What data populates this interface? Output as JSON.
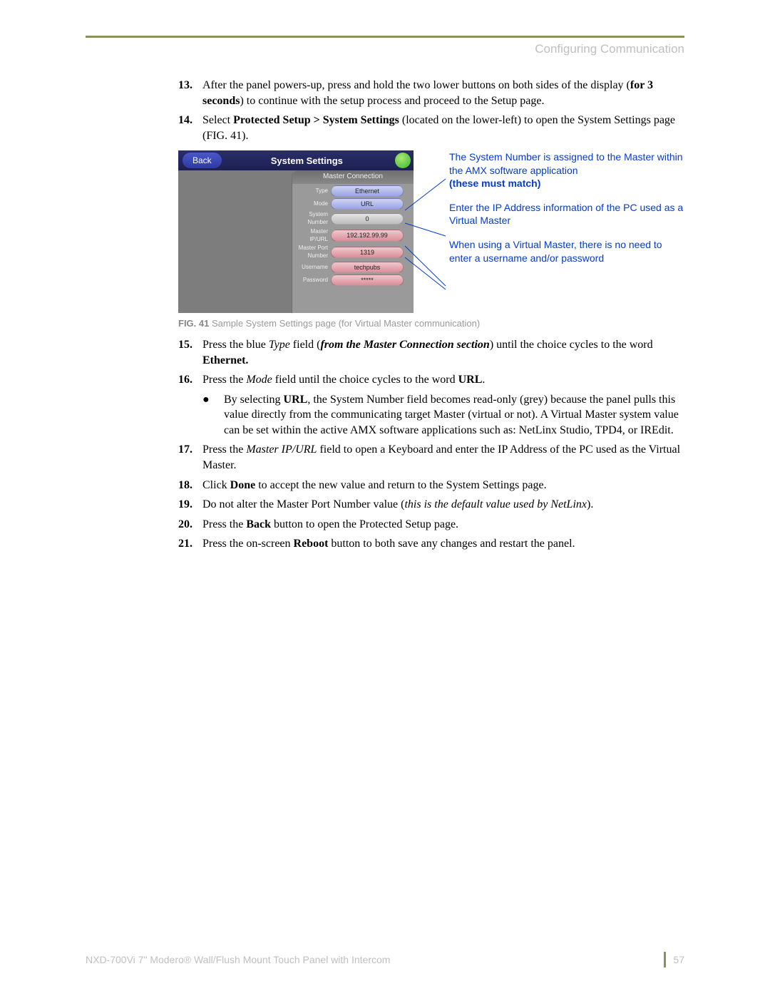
{
  "header": {
    "section": "Configuring Communication"
  },
  "steps": {
    "s13": {
      "num": "13.",
      "pre": "After the panel powers-up, press and hold the two lower buttons on both sides of the display (",
      "bold": "for 3 seconds",
      "post": ") to continue with the setup process and proceed to the Setup page."
    },
    "s14": {
      "num": "14.",
      "pre": "Select ",
      "bold": "Protected Setup > System Settings",
      "post": " (located on the lower-left) to open the System Settings page (FIG. 41)."
    },
    "s15": {
      "num": "15.",
      "t1": "Press the blue ",
      "it1": "Type",
      "t2": " field (",
      "bit": "from the Master Connection section",
      "t3": ") until the choice cycles to the word ",
      "b2": "Ethernet."
    },
    "s16": {
      "num": "16.",
      "t1": "Press the ",
      "it1": "Mode",
      "t2": " field until the choice cycles to the word ",
      "b1": "URL",
      "t3": "."
    },
    "s16b": {
      "t1": "By selecting ",
      "b1": "URL",
      "t2": ", the System Number field becomes read-only (grey) because the panel pulls this value directly from the communicating target Master (virtual or not). A Virtual Master system value can be set within the active AMX software applications such as: NetLinx Studio, TPD4, or IREdit."
    },
    "s17": {
      "num": "17.",
      "t1": "Press the ",
      "it1": "Master IP/URL",
      "t2": " field to open a Keyboard and enter the IP Address of the PC used as the Virtual Master."
    },
    "s18": {
      "num": "18.",
      "t1": "Click ",
      "b1": "Done",
      "t2": " to accept the new value and return to the System Settings page."
    },
    "s19": {
      "num": "19.",
      "t1": "Do not alter the Master Port Number value (",
      "it1": "this is the default value used by NetLinx",
      "t2": ")."
    },
    "s20": {
      "num": "20.",
      "t1": "Press the ",
      "b1": "Back",
      "t2": " button to open the Protected Setup page."
    },
    "s21": {
      "num": "21.",
      "t1": "Press the on-screen ",
      "b1": "Reboot",
      "t2": " button to both save any changes and restart the panel."
    }
  },
  "figure": {
    "back": "Back",
    "title": "System Settings",
    "panel_title": "Master Connection",
    "rows": {
      "type": {
        "label": "Type",
        "value": "Ethernet"
      },
      "mode": {
        "label": "Mode",
        "value": "URL"
      },
      "sysnum": {
        "label": "System Number",
        "value": "0"
      },
      "ip": {
        "label": "Master IP/URL",
        "value": "192.192.99.99"
      },
      "port": {
        "label": "Master Port Number",
        "value": "1319"
      },
      "user": {
        "label": "Username",
        "value": "techpubs"
      },
      "pass": {
        "label": "Password",
        "value": "*****"
      }
    },
    "caption_bold": "FIG. 41",
    "caption_rest": "  Sample System Settings page (for Virtual Master communication)"
  },
  "annot": {
    "a1_l1": "The System Number is assigned to the Master within the AMX software application",
    "a1_bold": "(these must match)",
    "a2": "Enter the IP Address information of the PC used as a Virtual Master",
    "a3": "When using a Virtual Master, there is no need to enter a username and/or password"
  },
  "footer": {
    "left": "NXD-700Vi 7\" Modero® Wall/Flush Mount Touch Panel with Intercom",
    "page": "57"
  }
}
